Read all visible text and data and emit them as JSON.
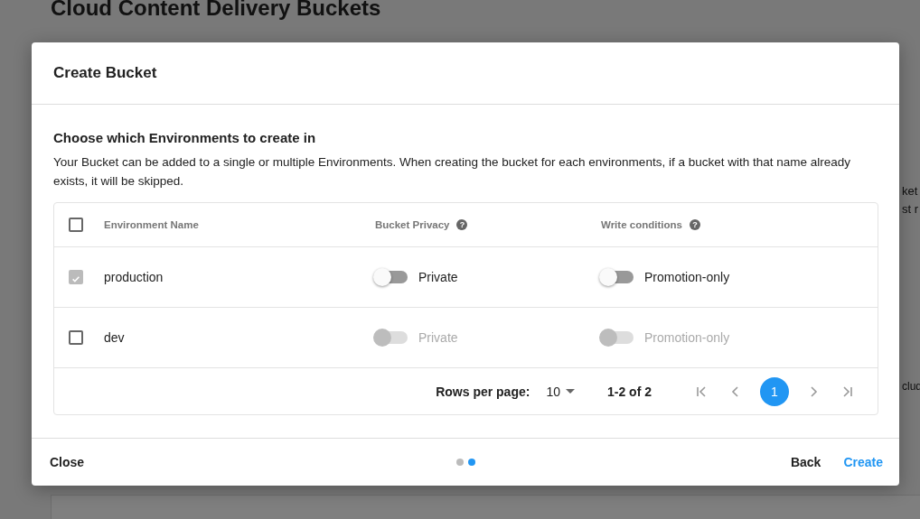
{
  "background": {
    "title": "Cloud Content Delivery Buckets",
    "fragments": [
      "ket",
      "st r",
      "clud"
    ]
  },
  "dialog": {
    "title": "Create Bucket",
    "section_title": "Choose which Environments to create in",
    "description": "Your Bucket can be added to a single or multiple Environments. When creating the bucket for each environments, if a bucket with that name already exists, it will be skipped.",
    "table": {
      "select_all": {
        "checked": false
      },
      "columns": [
        {
          "label": "Environment Name"
        },
        {
          "label": "Bucket Privacy",
          "help": "?"
        },
        {
          "label": "Write conditions",
          "help": "?"
        }
      ],
      "rows": [
        {
          "checked": true,
          "disabled": false,
          "name": "production",
          "privacy": {
            "on": false,
            "label": "Private"
          },
          "write": {
            "on": false,
            "label": "Promotion-only"
          }
        },
        {
          "checked": false,
          "disabled": true,
          "name": "dev",
          "privacy": {
            "on": false,
            "label": "Private"
          },
          "write": {
            "on": false,
            "label": "Promotion-only"
          }
        }
      ],
      "pagination": {
        "rows_per_page_label": "Rows per page:",
        "rows_per_page": "10",
        "range": "1-2 of 2",
        "pages": [
          {
            "label": "1",
            "selected": true
          }
        ]
      }
    },
    "footer": {
      "close": "Close",
      "steps": [
        {
          "selected": false
        },
        {
          "selected": true
        }
      ],
      "back": "Back",
      "create": "Create"
    }
  }
}
